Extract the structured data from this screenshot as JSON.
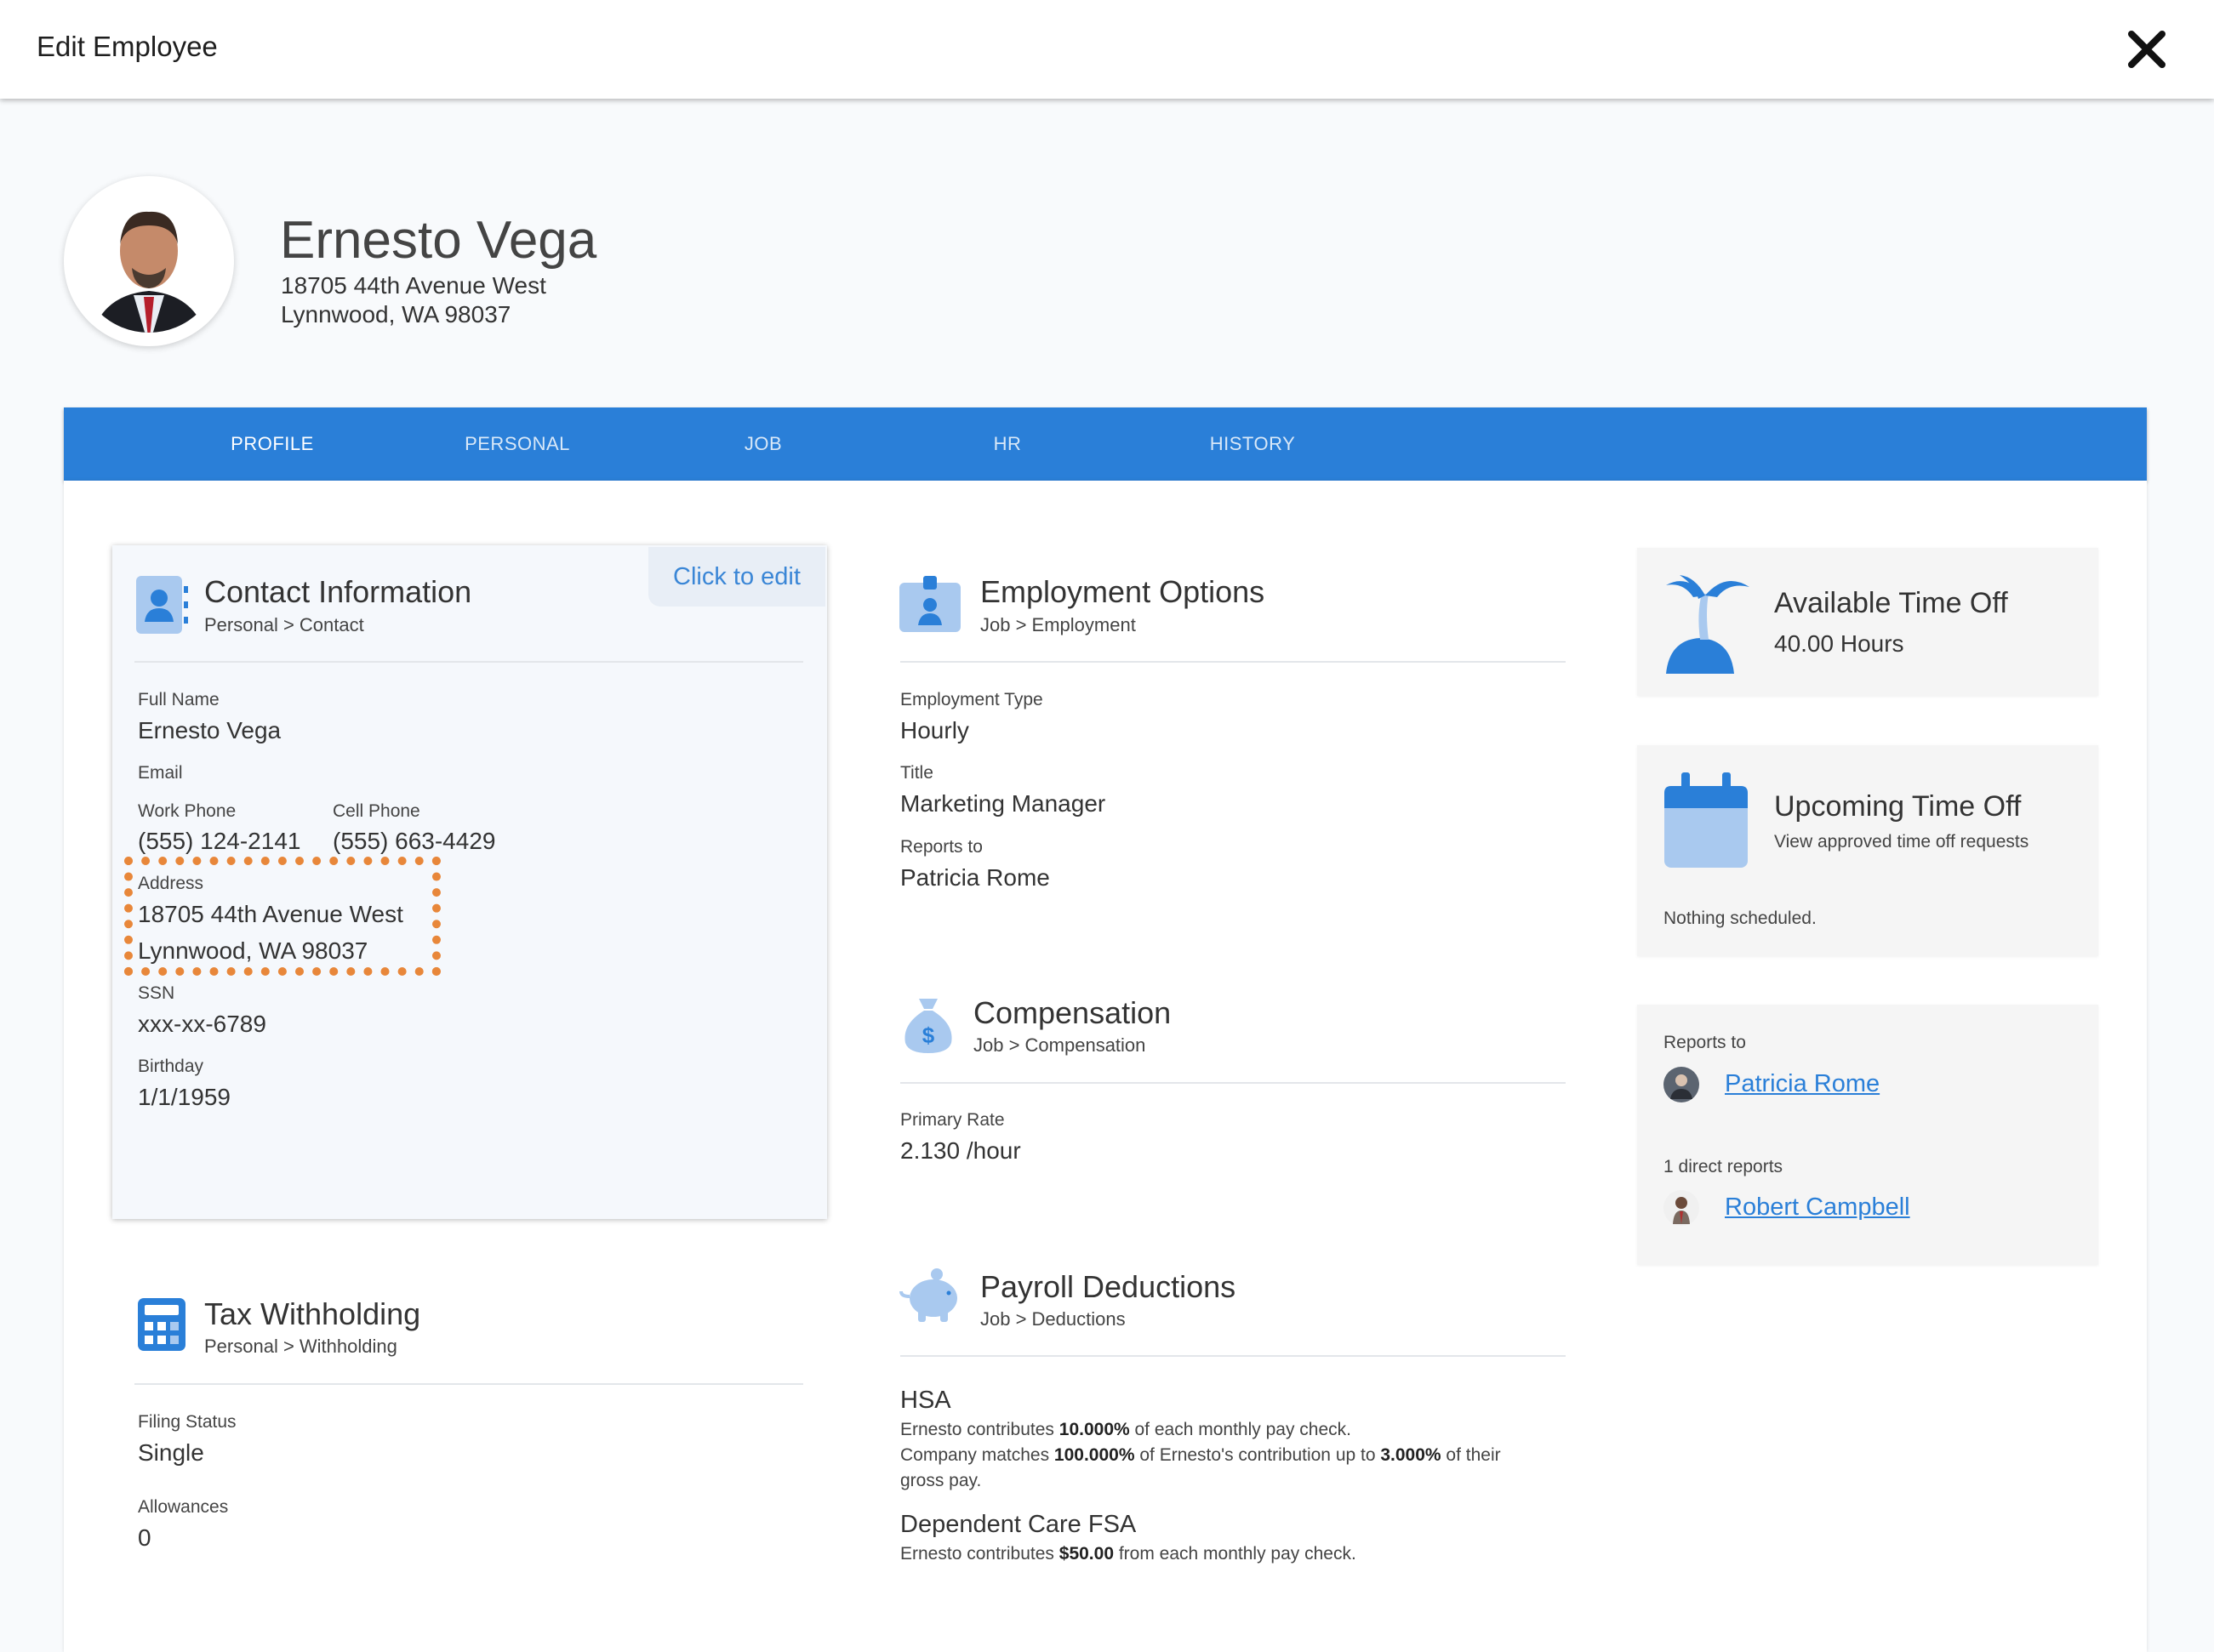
{
  "window": {
    "title": "Edit Employee",
    "close_icon": "close-icon"
  },
  "employee": {
    "name": "Ernesto Vega",
    "address_line1": "18705 44th Avenue West",
    "address_line2": "Lynnwood, WA 98037"
  },
  "tabs": [
    {
      "label": "PROFILE",
      "active": true
    },
    {
      "label": "PERSONAL"
    },
    {
      "label": "JOB"
    },
    {
      "label": "HR"
    },
    {
      "label": "HISTORY"
    }
  ],
  "contact": {
    "title": "Contact Information",
    "breadcrumb": "Personal > Contact",
    "edit_label": "Click to edit",
    "full_name_label": "Full Name",
    "full_name": "Ernesto Vega",
    "email_label": "Email",
    "work_phone_label": "Work Phone",
    "work_phone": "(555) 124-2141",
    "cell_phone_label": "Cell Phone",
    "cell_phone": "(555) 663-4429",
    "address_label": "Address",
    "address_line1": "18705 44th Avenue West",
    "address_line2": "Lynnwood, WA 98037",
    "ssn_label": "SSN",
    "ssn": "xxx-xx-6789",
    "birthday_label": "Birthday",
    "birthday": "1/1/1959"
  },
  "tax": {
    "title": "Tax Withholding",
    "breadcrumb": "Personal > Withholding",
    "filing_status_label": "Filing Status",
    "filing_status": "Single",
    "allowances_label": "Allowances",
    "allowances": "0"
  },
  "employment": {
    "title": "Employment Options",
    "breadcrumb": "Job > Employment",
    "type_label": "Employment Type",
    "type": "Hourly",
    "title_label": "Title",
    "job_title": "Marketing Manager",
    "reports_label": "Reports to",
    "reports_to": "Patricia Rome"
  },
  "compensation": {
    "title": "Compensation",
    "breadcrumb": "Job > Compensation",
    "rate_label": "Primary Rate",
    "rate": "2.130 /hour"
  },
  "payroll": {
    "title": "Payroll Deductions",
    "breadcrumb": "Job > Deductions",
    "hsa_title": "HSA",
    "hsa_line1_a": "Ernesto contributes ",
    "hsa_line1_b": "10.000%",
    "hsa_line1_c": " of each monthly pay check.",
    "hsa_line2_a": "Company matches ",
    "hsa_line2_b": "100.000%",
    "hsa_line2_c": " of Ernesto's contribution up to ",
    "hsa_line2_d": "3.000%",
    "hsa_line2_e": " of their gross pay.",
    "fsa_title": "Dependent Care FSA",
    "fsa_line_a": "Ernesto contributes ",
    "fsa_line_b": "$50.00",
    "fsa_line_c": " from each monthly pay check."
  },
  "time_off": {
    "available_title": "Available Time Off",
    "available_hours": "40.00 Hours",
    "upcoming_title": "Upcoming Time Off",
    "upcoming_sub": "View approved time off requests",
    "upcoming_empty": "Nothing scheduled."
  },
  "org": {
    "reports_label": "Reports to",
    "manager": "Patricia Rome",
    "direct_reports_label": "1 direct reports",
    "direct_report": "Robert Campbell"
  },
  "colors": {
    "accent": "#2a7fd8",
    "highlight": "#e8873a",
    "icon_light": "#a9c9ef"
  }
}
